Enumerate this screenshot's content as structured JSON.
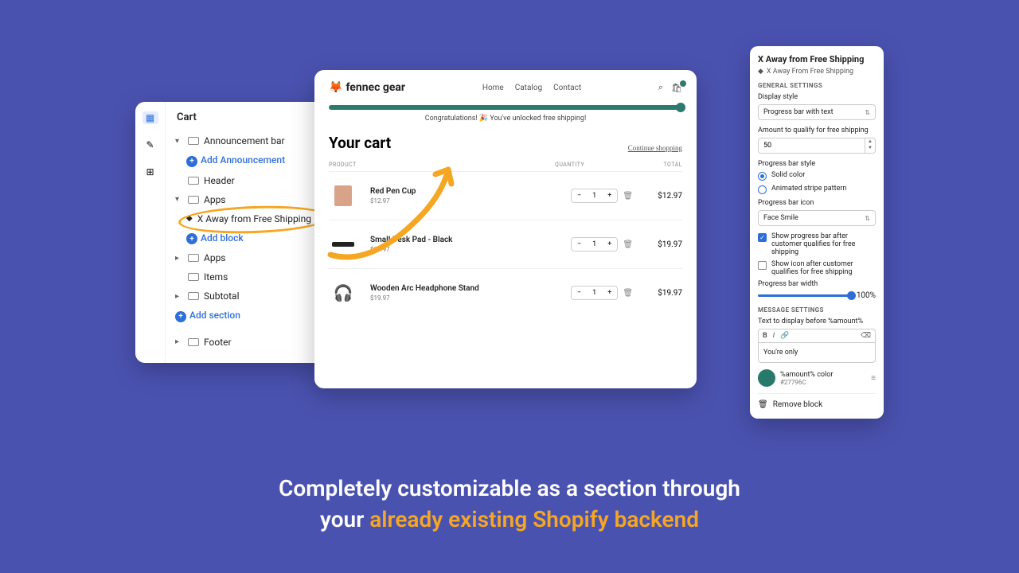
{
  "left": {
    "title": "Cart",
    "announce": "Announcement bar",
    "add_announce": "Add Announcement",
    "header": "Header",
    "apps": "Apps",
    "shipping_item": "X Away from Free Shipping",
    "add_block": "Add block",
    "apps2": "Apps",
    "items": "Items",
    "subtotal": "Subtotal",
    "add_section": "Add section",
    "footer": "Footer"
  },
  "store": {
    "brand": "fennec gear",
    "nav": {
      "home": "Home",
      "catalog": "Catalog",
      "contact": "Contact"
    },
    "congrats": "Congratulations! 🎉 You've unlocked free shipping!",
    "cart_title": "Your cart",
    "continue": "Continue shopping",
    "cols": {
      "product": "PRODUCT",
      "qty": "QUANTITY",
      "total": "TOTAL"
    },
    "rows": [
      {
        "name": "Red Pen Cup",
        "price": "$12.97",
        "qty": "1",
        "total": "$12.97"
      },
      {
        "name": "Small Desk Pad - Black",
        "price": "$19.97",
        "qty": "1",
        "total": "$19.97"
      },
      {
        "name": "Wooden Arc Headphone Stand",
        "price": "$19.97",
        "qty": "1",
        "total": "$19.97"
      }
    ]
  },
  "right": {
    "title": "X Away from Free Shipping",
    "sub": "X Away From Free Shipping",
    "sec_general": "GENERAL SETTINGS",
    "display_label": "Display style",
    "display_value": "Progress bar with text",
    "amount_label": "Amount to qualify for free shipping",
    "amount_value": "50",
    "pbs_label": "Progress bar style",
    "pbs_solid": "Solid color",
    "pbs_anim": "Animated stripe pattern",
    "icon_label": "Progress bar icon",
    "icon_value": "Face Smile",
    "chk_show_bar": "Show progress bar after customer qualifies for free shipping",
    "chk_show_icon": "Show icon after customer qualifies for free shipping",
    "width_label": "Progress bar width",
    "width_value": "100%",
    "sec_msg": "MESSAGE SETTINGS",
    "text_before_label": "Text to display before %amount%",
    "text_before_value": "You're only",
    "color_label": "%amount% color",
    "color_value": "#27796C",
    "remove": "Remove block"
  },
  "tagline": {
    "l1": "Completely customizable as a section through",
    "l2a": "your ",
    "l2b": "already existing Shopify backend"
  }
}
